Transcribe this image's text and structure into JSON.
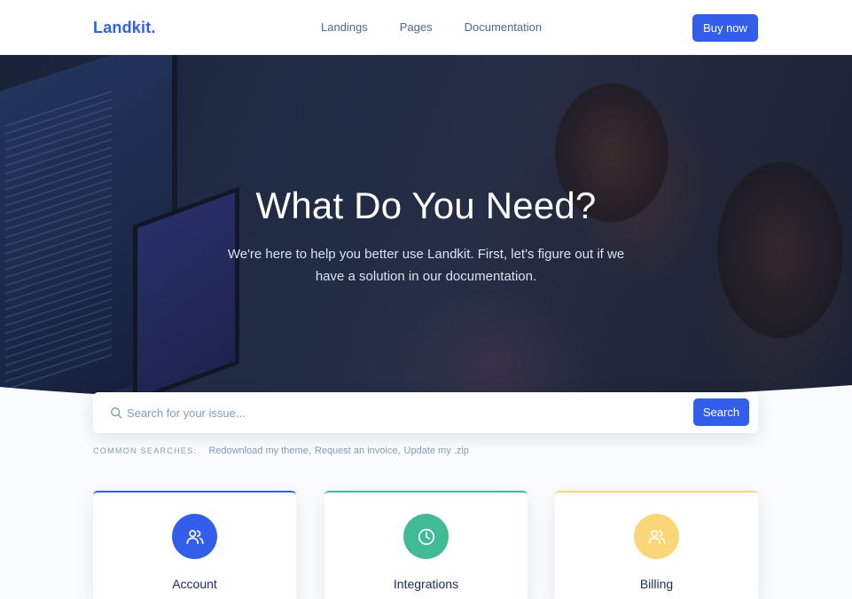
{
  "navbar": {
    "brand": "Landkit.",
    "links": [
      "Landings",
      "Pages",
      "Documentation"
    ],
    "cta_label": "Buy now"
  },
  "hero": {
    "title": "What Do You Need?",
    "subtitle": "We're here to help you better use Landkit. First, let's figure out if we have a solution in our documentation."
  },
  "search": {
    "placeholder": "Search for your issue...",
    "value": "",
    "button_label": "Search",
    "icon": "search-icon"
  },
  "common_searches": {
    "label": "COMMON SEARCHES:",
    "items": [
      "Redownload my theme",
      "Request an invoice",
      "Update my .zip"
    ]
  },
  "cards": [
    {
      "title": "Account",
      "icon": "users-icon",
      "accent": "#335eea",
      "circle": "#335eea"
    },
    {
      "title": "Integrations",
      "icon": "clock-icon",
      "accent": "#42ba96",
      "circle": "#42ba96"
    },
    {
      "title": "Billing",
      "icon": "users-icon",
      "accent": "#fad776",
      "circle": "#fad776"
    }
  ],
  "colors": {
    "primary": "#335eea",
    "text": "#1b2a4e",
    "muted": "#869ab8"
  }
}
